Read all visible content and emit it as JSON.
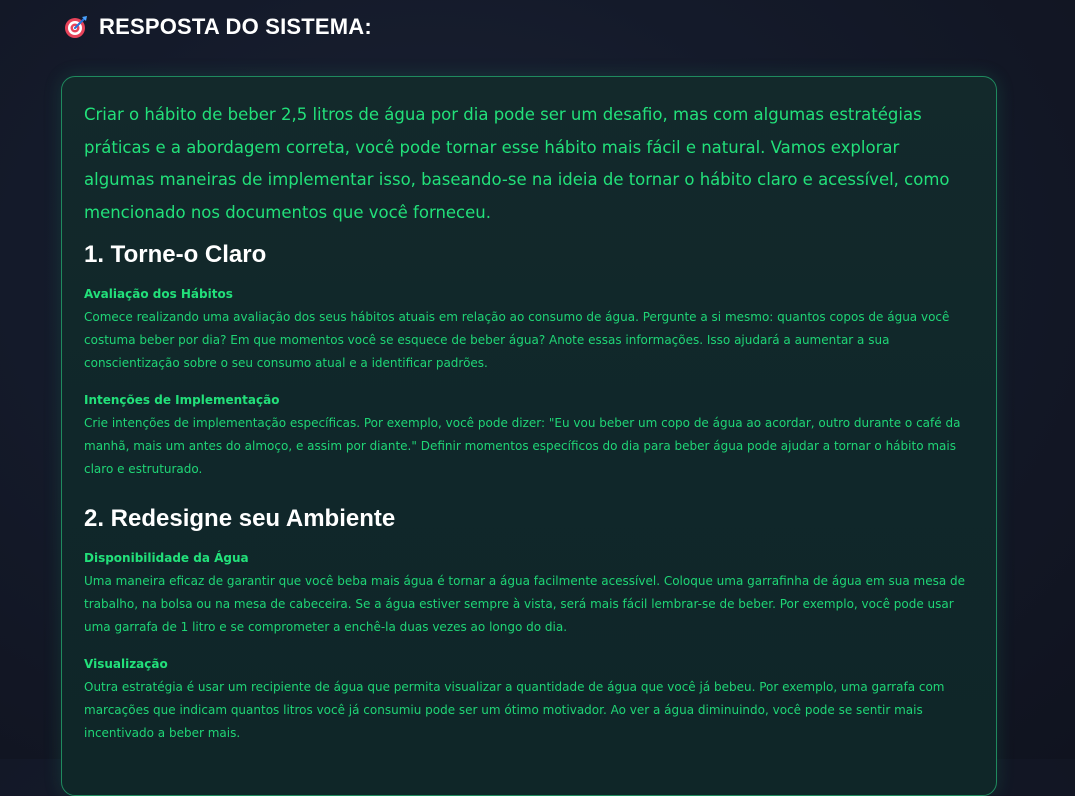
{
  "header": {
    "icon": "target-icon",
    "title": "RESPOSTA DO SISTEMA:"
  },
  "response": {
    "intro": "Criar o hábito de beber 2,5 litros de água por dia pode ser um desafio, mas com algumas estratégias práticas e a abordagem correta, você pode tornar esse hábito mais fácil e natural. Vamos explorar algumas maneiras de implementar isso, baseando-se na ideia de tornar o hábito claro e acessível, como mencionado nos documentos que você forneceu.",
    "sections": [
      {
        "heading": "1. Torne-o Claro",
        "items": [
          {
            "title": "Avaliação dos Hábitos",
            "body": "Comece realizando uma avaliação dos seus hábitos atuais em relação ao consumo de água. Pergunte a si mesmo: quantos copos de água você costuma beber por dia? Em que momentos você se esquece de beber água? Anote essas informações. Isso ajudará a aumentar a sua conscientização sobre o seu consumo atual e a identificar padrões."
          },
          {
            "title": "Intenções de Implementação",
            "body": "Crie intenções de implementação específicas. Por exemplo, você pode dizer: \"Eu vou beber um copo de água ao acordar, outro durante o café da manhã, mais um antes do almoço, e assim por diante.\" Definir momentos específicos do dia para beber água pode ajudar a tornar o hábito mais claro e estruturado."
          }
        ]
      },
      {
        "heading": "2. Redesigne seu Ambiente",
        "items": [
          {
            "title": "Disponibilidade da Água",
            "body": "Uma maneira eficaz de garantir que você beba mais água é tornar a água facilmente acessível. Coloque uma garrafinha de água em sua mesa de trabalho, na bolsa ou na mesa de cabeceira. Se a água estiver sempre à vista, será mais fácil lembrar-se de beber. Por exemplo, você pode usar uma garrafa de 1 litro e se comprometer a enchê-la duas vezes ao longo do dia."
          },
          {
            "title": "Visualização",
            "body": "Outra estratégia é usar um recipiente de água que permita visualizar a quantidade de água que você já bebeu. Por exemplo, uma garrafa com marcações que indicam quantos litros você já consumiu pode ser um ótimo motivador. Ao ver a água diminuindo, você pode se sentir mais incentivado a beber mais."
          }
        ]
      }
    ]
  },
  "colors": {
    "accent_text": "#22e07a",
    "card_border": "#1f8a5e",
    "heading": "#ffffff",
    "background": "#141a2a"
  }
}
